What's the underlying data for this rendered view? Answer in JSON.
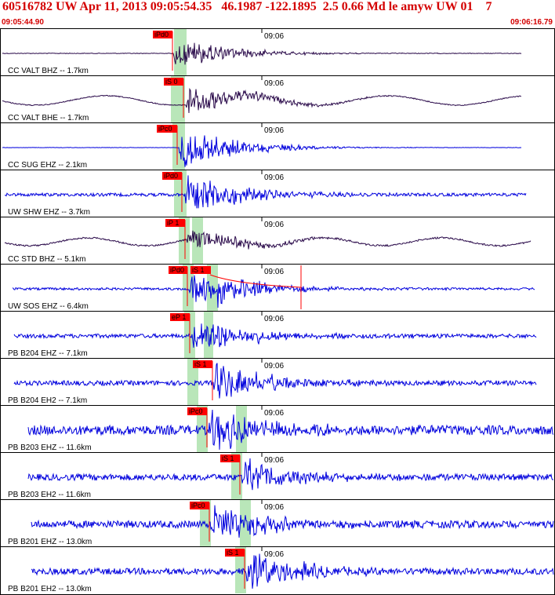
{
  "header": {
    "title": "60516782 UW Apr 11, 2013 09:05:54.35   46.1987 -122.1895  2.5 0.66 Md le amyw UW 01    7",
    "time_start": "09:05:44.90",
    "time_end": "09:06:16.79"
  },
  "colors": {
    "header_text": "#d40000",
    "trace_dark": "#2a0a4a",
    "trace_blue": "#0000dd",
    "pick_box": "#ff0000",
    "pick_window": "#b9e6b9",
    "border": "#000000"
  },
  "time_tick_label": "09:06",
  "traces": [
    {
      "label": "CC VALT BHZ -- 1.7km",
      "color": "dark",
      "pick": "iPd0",
      "s_pick": ""
    },
    {
      "label": "CC VALT BHE -- 1.7km",
      "color": "dark",
      "pick": "iS 0",
      "s_pick": ""
    },
    {
      "label": "CC SUG EHZ -- 2.1km",
      "color": "blue",
      "pick": "iPc0",
      "s_pick": ""
    },
    {
      "label": "UW SHW EHZ -- 3.7km",
      "color": "blue",
      "pick": "iPd0",
      "s_pick": ""
    },
    {
      "label": "CC STD BHZ -- 5.1km",
      "color": "dark",
      "pick": "iP 1",
      "s_pick": ""
    },
    {
      "label": "UW SOS EHZ -- 6.4km",
      "color": "blue",
      "pick": "iPd0",
      "s_pick": "iS 1"
    },
    {
      "label": "PB B204 EHZ -- 7.1km",
      "color": "blue",
      "pick": "eP 1",
      "s_pick": ""
    },
    {
      "label": "PB B204 EH2 -- 7.1km",
      "color": "blue",
      "pick": "iS 1",
      "s_pick": ""
    },
    {
      "label": "PB B203 EHZ -- 11.6km",
      "color": "blue",
      "pick": "iPc0",
      "s_pick": ""
    },
    {
      "label": "PB B203 EH2 -- 11.6km",
      "color": "blue",
      "pick": "iS 1",
      "s_pick": ""
    },
    {
      "label": "PB B201 EHZ -- 13.0km",
      "color": "blue",
      "pick": "iPc0",
      "s_pick": ""
    },
    {
      "label": "PB B201 EH2 -- 13.0km",
      "color": "blue",
      "pick": "iS 1",
      "s_pick": ""
    }
  ]
}
